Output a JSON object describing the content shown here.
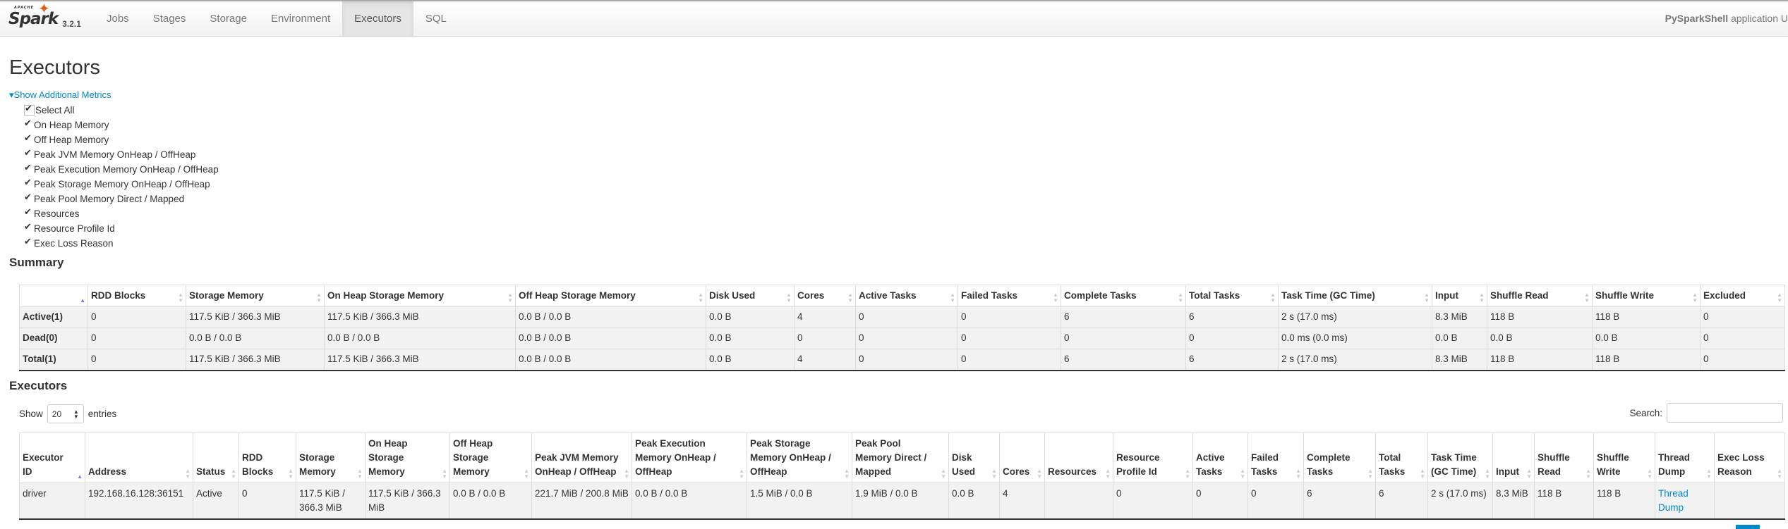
{
  "nav": {
    "logo_text": "Spark",
    "logo_small": "APACHE",
    "version": "3.2.1",
    "tabs": [
      "Jobs",
      "Stages",
      "Storage",
      "Environment",
      "Executors",
      "SQL"
    ],
    "active_tab": "Executors",
    "app_name": "PySparkShell",
    "app_suffix": "application U"
  },
  "page_title": "Executors",
  "metrics": {
    "toggle_label": "Show Additional Metrics",
    "items": [
      "Select All",
      "On Heap Memory",
      "Off Heap Memory",
      "Peak JVM Memory OnHeap / OffHeap",
      "Peak Execution Memory OnHeap / OffHeap",
      "Peak Storage Memory OnHeap / OffHeap",
      "Peak Pool Memory Direct / Mapped",
      "Resources",
      "Resource Profile Id",
      "Exec Loss Reason"
    ]
  },
  "summary": {
    "title": "Summary",
    "headers": [
      "",
      "RDD Blocks",
      "Storage Memory",
      "On Heap Storage Memory",
      "Off Heap Storage Memory",
      "Disk Used",
      "Cores",
      "Active Tasks",
      "Failed Tasks",
      "Complete Tasks",
      "Total Tasks",
      "Task Time (GC Time)",
      "Input",
      "Shuffle Read",
      "Shuffle Write",
      "Excluded"
    ],
    "rows": [
      [
        "Active(1)",
        "0",
        "117.5 KiB / 366.3 MiB",
        "117.5 KiB / 366.3 MiB",
        "0.0 B / 0.0 B",
        "0.0 B",
        "4",
        "0",
        "0",
        "6",
        "6",
        "2 s (17.0 ms)",
        "8.3 MiB",
        "118 B",
        "118 B",
        "0"
      ],
      [
        "Dead(0)",
        "0",
        "0.0 B / 0.0 B",
        "0.0 B / 0.0 B",
        "0.0 B / 0.0 B",
        "0.0 B",
        "0",
        "0",
        "0",
        "0",
        "0",
        "0.0 ms (0.0 ms)",
        "0.0 B",
        "0.0 B",
        "0.0 B",
        "0"
      ],
      [
        "Total(1)",
        "0",
        "117.5 KiB / 366.3 MiB",
        "117.5 KiB / 366.3 MiB",
        "0.0 B / 0.0 B",
        "0.0 B",
        "4",
        "0",
        "0",
        "6",
        "6",
        "2 s (17.0 ms)",
        "8.3 MiB",
        "118 B",
        "118 B",
        "0"
      ]
    ]
  },
  "executors": {
    "title": "Executors",
    "show_label": "Show",
    "entries_value": "20",
    "entries_label": "entries",
    "search_label": "Search:",
    "search_value": "",
    "headers": [
      "Executor ID",
      "Address",
      "Status",
      "RDD Blocks",
      "Storage Memory",
      "On Heap Storage Memory",
      "Off Heap Storage Memory",
      "Peak JVM Memory OnHeap / OffHeap",
      "Peak Execution Memory OnHeap / OffHeap",
      "Peak Storage Memory OnHeap / OffHeap",
      "Peak Pool Memory Direct / Mapped",
      "Disk Used",
      "Cores",
      "Resources",
      "Resource Profile Id",
      "Active Tasks",
      "Failed Tasks",
      "Complete Tasks",
      "Total Tasks",
      "Task Time (GC Time)",
      "Input",
      "Shuffle Read",
      "Shuffle Write",
      "Thread Dump",
      "Exec Loss Reason"
    ],
    "rows": [
      [
        "driver",
        "192.168.16.128:36151",
        "Active",
        "0",
        "117.5 KiB / 366.3 MiB",
        "117.5 KiB / 366.3 MiB",
        "0.0 B / 0.0 B",
        "221.7 MiB / 200.8 MiB",
        "0.0 B / 0.0 B",
        "1.5 MiB / 0.0 B",
        "1.9 MiB / 0.0 B",
        "0.0 B",
        "4",
        "",
        "0",
        "0",
        "0",
        "6",
        "6",
        "2 s (17.0 ms)",
        "8.3 MiB",
        "118 B",
        "118 B",
        "Thread Dump",
        ""
      ]
    ]
  },
  "colors": {
    "accent": "#0088cc",
    "logo_star": "#e25a1c",
    "sort_active": "#7a7ae6"
  }
}
